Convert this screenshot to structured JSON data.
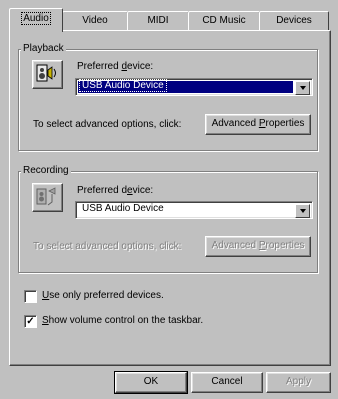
{
  "tabs": [
    {
      "label": "Audio"
    },
    {
      "label": "Video"
    },
    {
      "label": "MIDI"
    },
    {
      "label": "CD Music"
    },
    {
      "label": "Devices"
    }
  ],
  "playback": {
    "legend": "Playback",
    "preferred_label_pre": "Preferred ",
    "preferred_label_key": "d",
    "preferred_label_post": "evice:",
    "device": "USB Audio Device",
    "advanced_text": "To select advanced options, click:",
    "advanced_button_pre": "Advanced ",
    "advanced_button_key": "P",
    "advanced_button_post": "roperties"
  },
  "recording": {
    "legend": "Recording",
    "preferred_label_pre": "Preferred d",
    "preferred_label_key": "e",
    "preferred_label_post": "vice:",
    "device": "USB Audio Device",
    "advanced_text": "To select advanced options, click:",
    "advanced_button_pre": "Advanced ",
    "advanced_button_key": "P",
    "advanced_button_post": "roperties"
  },
  "options": {
    "use_only_key": "U",
    "use_only_rest": "se only preferred devices.",
    "use_only_checked": false,
    "show_volume_key": "S",
    "show_volume_rest": "how volume control on the taskbar.",
    "show_volume_checked": true,
    "check_mark": "✓"
  },
  "footer": {
    "ok": "OK",
    "cancel": "Cancel",
    "apply": "Apply"
  },
  "colors": {
    "selection": "#000080",
    "face": "#c0c0c0"
  }
}
